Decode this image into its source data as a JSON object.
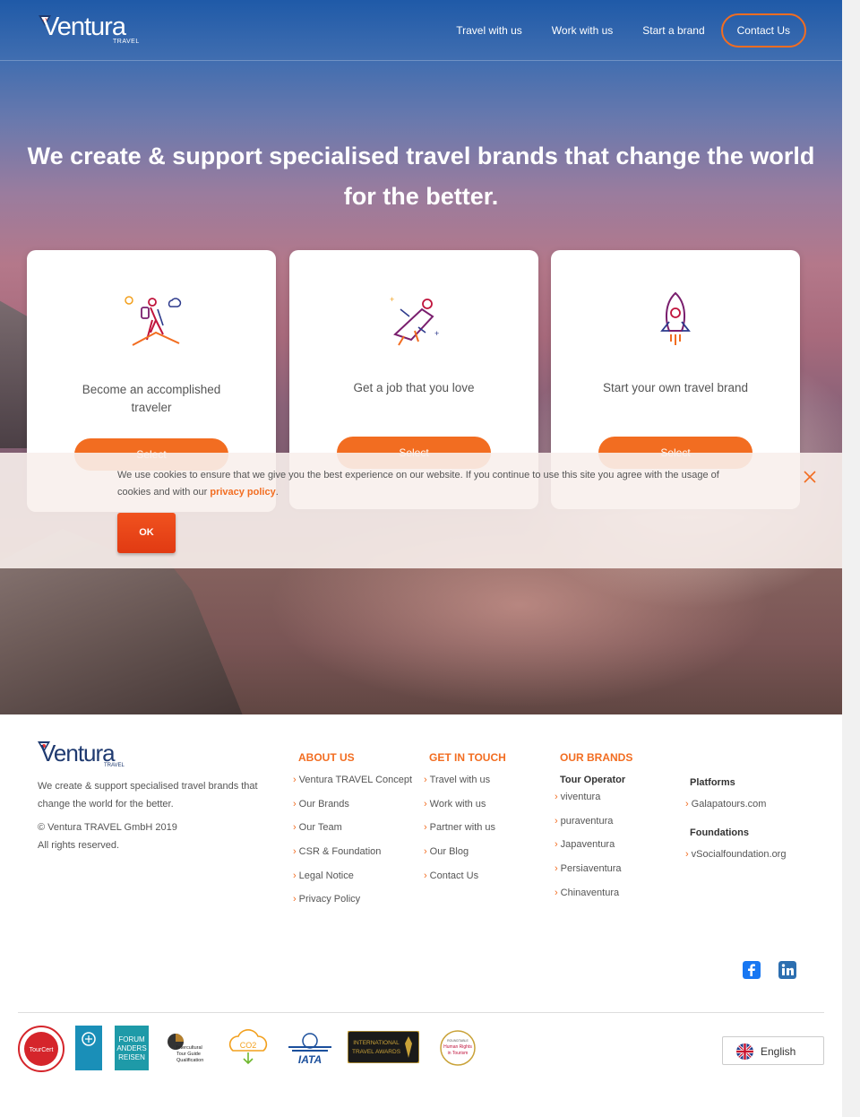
{
  "header": {
    "logo_text": "Ventura",
    "logo_sub": "TRAVEL",
    "nav": [
      "Travel with us",
      "Work with us",
      "Start a brand"
    ],
    "contact_label": "Contact Us"
  },
  "hero": {
    "headline": "We create & support specialised travel brands that change the world for the better."
  },
  "cards": [
    {
      "text": "Become an accomplished traveler",
      "button": "Select",
      "icon": "hiker-icon"
    },
    {
      "text": "Get a job that you love",
      "button": "Select",
      "icon": "flying-person-icon"
    },
    {
      "text": "Start your own travel brand",
      "button": "Select",
      "icon": "rocket-icon"
    }
  ],
  "cookie": {
    "message": "We use cookies to ensure that we give you the best experience on our website. If you continue to use this site you agree with the usage of cookies and with our",
    "link": "privacy policy",
    "end": ".",
    "ok_label": "OK"
  },
  "footer": {
    "logo_text": "Ventura",
    "logo_sub": "TRAVEL",
    "description": "We create & support specialised travel brands that change the world for the better.",
    "copyright": "© Ventura TRAVEL GmbH 2019",
    "rights": "All rights reserved.",
    "about": {
      "title": "ABOUT US",
      "items": [
        "Ventura TRAVEL Concept",
        "Our Brands",
        "Our Team",
        "CSR & Foundation",
        "Legal Notice",
        "Privacy Policy"
      ]
    },
    "touch": {
      "title": "GET IN TOUCH",
      "items": [
        "Travel with us",
        "Work with us",
        "Partner with us",
        "Our Blog",
        "Contact Us"
      ]
    },
    "brands": {
      "title": "OUR BRANDS",
      "tour_operator_label": "Tour Operator",
      "items": [
        "viventura",
        "puraventura",
        "Japaventura",
        "Persiaventura",
        "Chinaventura"
      ]
    },
    "platforms": {
      "label": "Platforms",
      "items": [
        "Galapatours.com"
      ],
      "foundations_label": "Foundations",
      "foundations": [
        "vSocialfoundation.org"
      ]
    },
    "language": "English",
    "badges": {
      "tourcert": "TourCert",
      "forum": [
        "FORUM",
        "ANDERS",
        "REISEN"
      ],
      "intercultural": [
        "Intercultural",
        "Tour Guide",
        "Qualification"
      ],
      "co2": "CO2",
      "iata": "IATA",
      "awards": [
        "INTERNATIONAL",
        "TRAVEL AWARDS"
      ],
      "human": [
        "ROUNDTABLE",
        "Human Rights",
        "in Tourism"
      ]
    }
  },
  "colors": {
    "accent": "#f26d21",
    "brand_navy": "#1f3a70",
    "facebook": "#1877f2",
    "linkedin": "#2d6fb0"
  }
}
